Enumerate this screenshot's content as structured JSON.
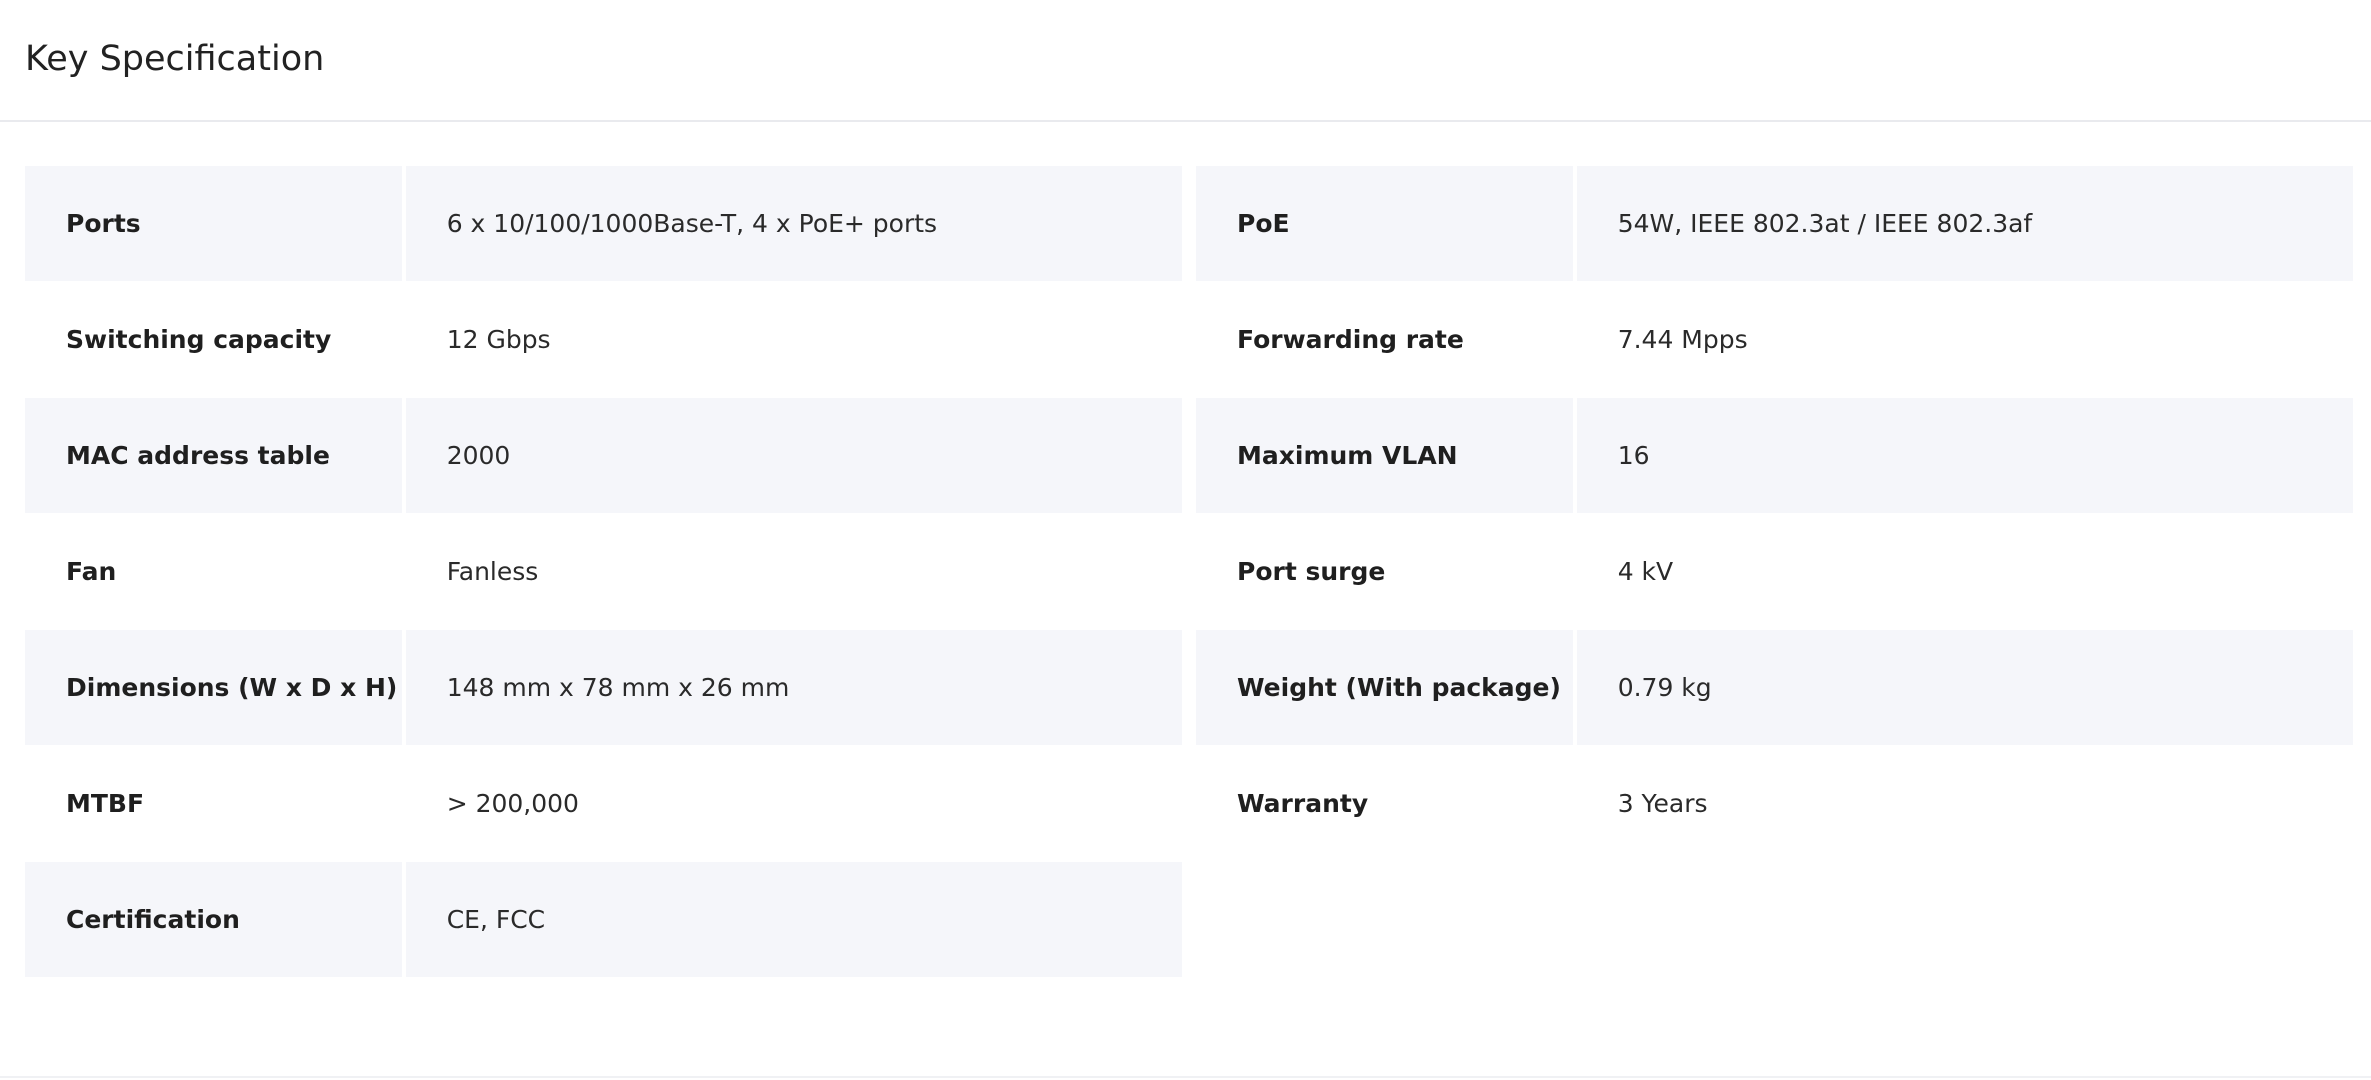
{
  "header": {
    "title": "Key Specification"
  },
  "specs_left": [
    {
      "label": "Ports",
      "value": "6 x 10/100/1000Base-T, 4 x PoE+ ports"
    },
    {
      "label": "Switching capacity",
      "value": "12 Gbps"
    },
    {
      "label": "MAC address table",
      "value": "2000"
    },
    {
      "label": "Fan",
      "value": "Fanless"
    },
    {
      "label": "Dimensions (W x D x H)",
      "value": "148 mm x 78 mm x 26 mm"
    },
    {
      "label": "MTBF",
      "value": "> 200,000"
    },
    {
      "label": "Certification",
      "value": "CE, FCC"
    }
  ],
  "specs_right": [
    {
      "label": "PoE",
      "value": "54W, IEEE 802.3at / IEEE 802.3af"
    },
    {
      "label": "Forwarding rate",
      "value": "7.44 Mpps"
    },
    {
      "label": "Maximum VLAN",
      "value": "16"
    },
    {
      "label": "Port surge",
      "value": "4 kV"
    },
    {
      "label": "Weight (With package)",
      "value": "0.79 kg"
    },
    {
      "label": "Warranty",
      "value": "3 Years"
    }
  ],
  "colors": {
    "shaded_row": "#f5f6fa",
    "divider": "#e9eaee",
    "text": "#1f1f1f"
  }
}
